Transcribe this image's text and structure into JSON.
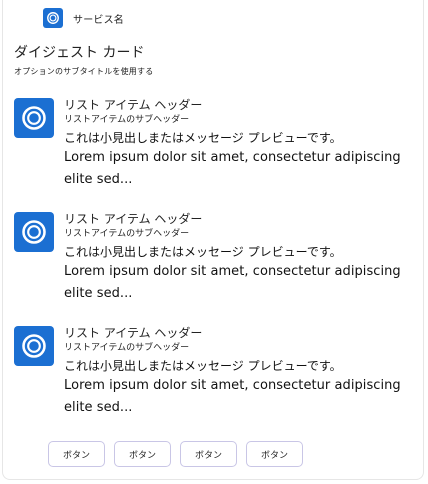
{
  "app": {
    "name": "サービス名",
    "icon": "app-logo-icon"
  },
  "card": {
    "title": "ダイジェスト カード",
    "subtitle": "オプションのサブタイトルを使用する"
  },
  "items": [
    {
      "header": "リスト アイテム ヘッダー",
      "subheader": "リストアイテムのサブヘッダー",
      "preview": "これは小見出しまたはメッセージ プレビューです。",
      "body": "Lorem ipsum dolor sit amet, consectetur adipiscing elite sed...",
      "icon": "app-logo-icon"
    },
    {
      "header": "リスト アイテム ヘッダー",
      "subheader": "リストアイテムのサブヘッダー",
      "preview": "これは小見出しまたはメッセージ プレビューです。",
      "body": "Lorem ipsum dolor sit amet, consectetur adipiscing elite sed...",
      "icon": "app-logo-icon"
    },
    {
      "header": "リスト アイテム ヘッダー",
      "subheader": "リストアイテムのサブヘッダー",
      "preview": "これは小見出しまたはメッセージ プレビューです。",
      "body": "Lorem ipsum dolor sit amet, consectetur adipiscing elite sed...",
      "icon": "app-logo-icon"
    }
  ],
  "buttons": [
    "ボタン",
    "ボタン",
    "ボタン",
    "ボタン"
  ],
  "colors": {
    "accent": "#1b6fd2",
    "button_border": "#c9c6e6"
  }
}
